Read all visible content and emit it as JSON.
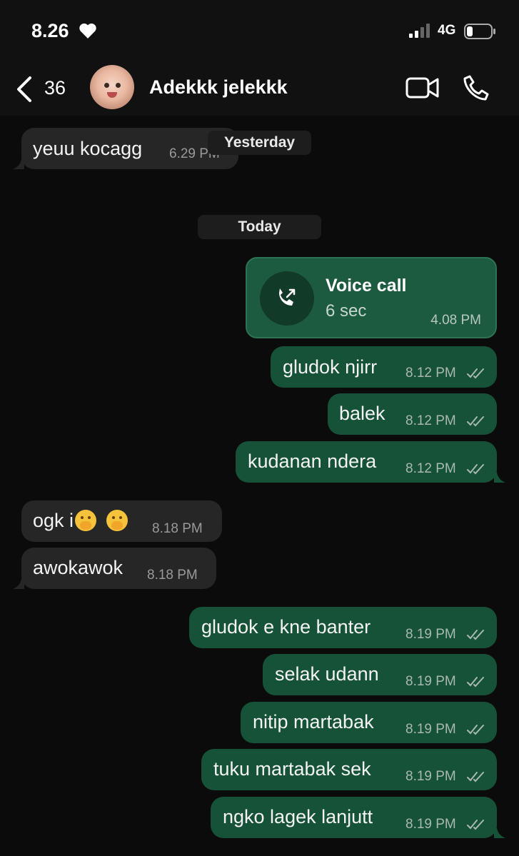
{
  "status_bar": {
    "time": "8.26",
    "network": "4G"
  },
  "header": {
    "back_count": "36",
    "contact_name": "Adekkk jelekkk"
  },
  "dividers": {
    "yesterday": "Yesterday",
    "today": "Today"
  },
  "call": {
    "title": "Voice call",
    "duration": "6 sec",
    "time": "4.08 PM"
  },
  "messages": [
    {
      "dir": "in",
      "text": "yeuu kocagg",
      "time": "6.29 PM"
    },
    {
      "dir": "out",
      "text": "gludok njirr",
      "time": "8.12 PM"
    },
    {
      "dir": "out",
      "text": "balek",
      "time": "8.12 PM"
    },
    {
      "dir": "out",
      "text": "kudanan ndera",
      "time": "8.12 PM"
    },
    {
      "dir": "in",
      "text": "ogk i",
      "time": "8.18 PM",
      "emojis": [
        "hand-over-mouth-emoji",
        "hand-over-mouth-emoji"
      ]
    },
    {
      "dir": "in",
      "text": "awokawok",
      "time": "8.18 PM"
    },
    {
      "dir": "out",
      "text": "gludok e kne banter",
      "time": "8.19 PM"
    },
    {
      "dir": "out",
      "text": "selak udann",
      "time": "8.19 PM"
    },
    {
      "dir": "out",
      "text": "nitip martabak",
      "time": "8.19 PM"
    },
    {
      "dir": "out",
      "text": "tuku martabak sek",
      "time": "8.19 PM"
    },
    {
      "dir": "out",
      "text": "ngko lagek lanjutt",
      "time": "8.19 PM"
    }
  ],
  "colors": {
    "incoming_bubble": "#262626",
    "outgoing_bubble": "#165238",
    "background": "#0b0b0b"
  }
}
